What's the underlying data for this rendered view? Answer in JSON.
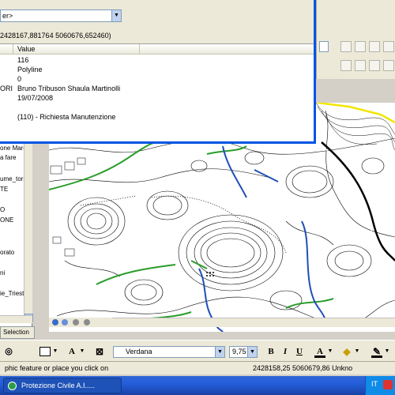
{
  "identify": {
    "layer_select_value": "er>",
    "location": "2428167,881764  5060676,652460)",
    "column_value": "Value",
    "rows": [
      {
        "field": "",
        "value": "116"
      },
      {
        "field": "",
        "value": "Polyline"
      },
      {
        "field": "",
        "value": "0"
      },
      {
        "field": "ORI",
        "value": "Bruno Tribuson Shaula Martinolli"
      },
      {
        "field": "",
        "value": "19/07/2008"
      },
      {
        "field": "",
        "value": ""
      },
      {
        "field": "",
        "value": "(110) - Richiesta Manutenzione"
      }
    ]
  },
  "toc": {
    "items": [
      "one Marci",
      "a fare",
      "",
      "ume_torre",
      "TE",
      "",
      "O",
      "ONE",
      "",
      "",
      "orato",
      "",
      "ni",
      "",
      "ie_Trieste"
    ],
    "tab_label": "Selection"
  },
  "drawing_toolbar": {
    "font_name": "Verdana",
    "font_size": "9,75",
    "bold_label": "B",
    "italic_label": "I",
    "underline_label": "U"
  },
  "status": {
    "message": "phic feature or place you click on",
    "coordinates": "2428158,25  5060679,86 Unkno"
  },
  "taskbar": {
    "task_label": "Protezione Civile A.I.....",
    "language": "IT"
  },
  "colors": {
    "title_blue": "#0054e3",
    "taskbar_blue": "#245edb",
    "map_green": "#2a9d2a",
    "map_blue": "#1f4fb8",
    "map_yellow": "#f2e600"
  }
}
